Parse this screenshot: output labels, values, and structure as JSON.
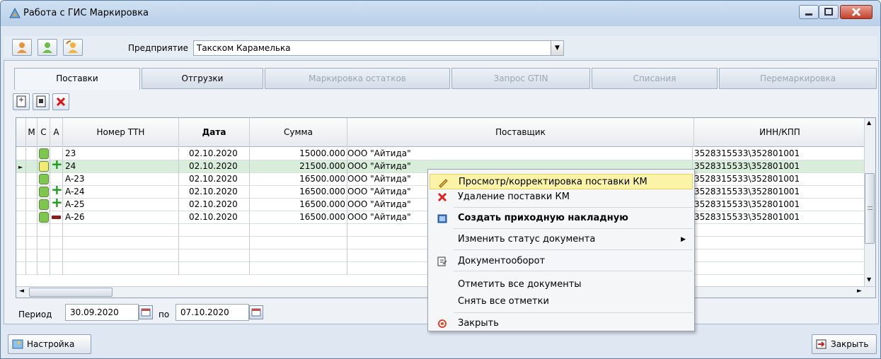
{
  "window": {
    "title": "Работа с ГИС Маркировка"
  },
  "toolbar": {
    "enterprise_label": "Предприятие",
    "enterprise_value": "Такском Карамелька"
  },
  "tabs": [
    {
      "label": "Поставки",
      "active": true,
      "enabled": true
    },
    {
      "label": "Отгрузки",
      "active": false,
      "enabled": true
    },
    {
      "label": "Маркировка остатков",
      "active": false,
      "enabled": false
    },
    {
      "label": "Запрос GTIN",
      "active": false,
      "enabled": false
    },
    {
      "label": "Списания",
      "active": false,
      "enabled": false
    },
    {
      "label": "Перемаркировка",
      "active": false,
      "enabled": false
    }
  ],
  "grid": {
    "headers": {
      "m": "M",
      "c": "C",
      "a": "A",
      "ttn": "Номер ТТН",
      "date": "Дата",
      "sum": "Сумма",
      "supplier": "Поставщик",
      "inn": "ИНН/КПП"
    },
    "rows": [
      {
        "ttn": "23",
        "date": "02.10.2020",
        "sum": "15000.000",
        "supplier": "ООО \"Айтида\"",
        "inn": "3528315533\\352801001",
        "status": "green",
        "a": "",
        "selected": false
      },
      {
        "ttn": "24",
        "date": "02.10.2020",
        "sum": "21500.000",
        "supplier": "ООО \"Айтида\"",
        "inn": "3528315533\\352801001",
        "status": "yellow",
        "a": "plus",
        "selected": true
      },
      {
        "ttn": "A-23",
        "date": "02.10.2020",
        "sum": "16500.000",
        "supplier": "ООО \"Айтида\"",
        "inn": "3528315533\\352801001",
        "status": "green",
        "a": "",
        "selected": false
      },
      {
        "ttn": "A-24",
        "date": "02.10.2020",
        "sum": "16500.000",
        "supplier": "ООО \"Айтида\"",
        "inn": "3528315533\\352801001",
        "status": "green",
        "a": "plus",
        "selected": false
      },
      {
        "ttn": "A-25",
        "date": "02.10.2020",
        "sum": "16500.000",
        "supplier": "ООО \"Айтида\"",
        "inn": "3528315533\\352801001",
        "status": "green",
        "a": "plus",
        "selected": false
      },
      {
        "ttn": "A-26",
        "date": "02.10.2020",
        "sum": "16500.000",
        "supplier": "ООО \"Айтида\"",
        "inn": "3528315533\\352801001",
        "status": "green",
        "a": "badge",
        "selected": false
      }
    ]
  },
  "period": {
    "label": "Период",
    "from": "30.09.2020",
    "to_label": "по",
    "to": "07.10.2020"
  },
  "bottom": {
    "settings_label": "Настройка",
    "close_label": "Закрыть"
  },
  "context_menu": {
    "items": [
      "Просмотр/корректировка поставки КМ",
      "Удаление поставки КМ",
      "Создать приходную накладную",
      "Изменить статус документа",
      "Документооборот",
      "Отметить все документы",
      "Снять все отметки",
      "Закрыть"
    ]
  },
  "colors": {
    "selected_row": "#d9eeda",
    "status_green": "#7ec64e",
    "status_yellow": "#f3ea74",
    "plus_green": "#1f9b1f",
    "menu_highlight": "#fbf3a8"
  }
}
